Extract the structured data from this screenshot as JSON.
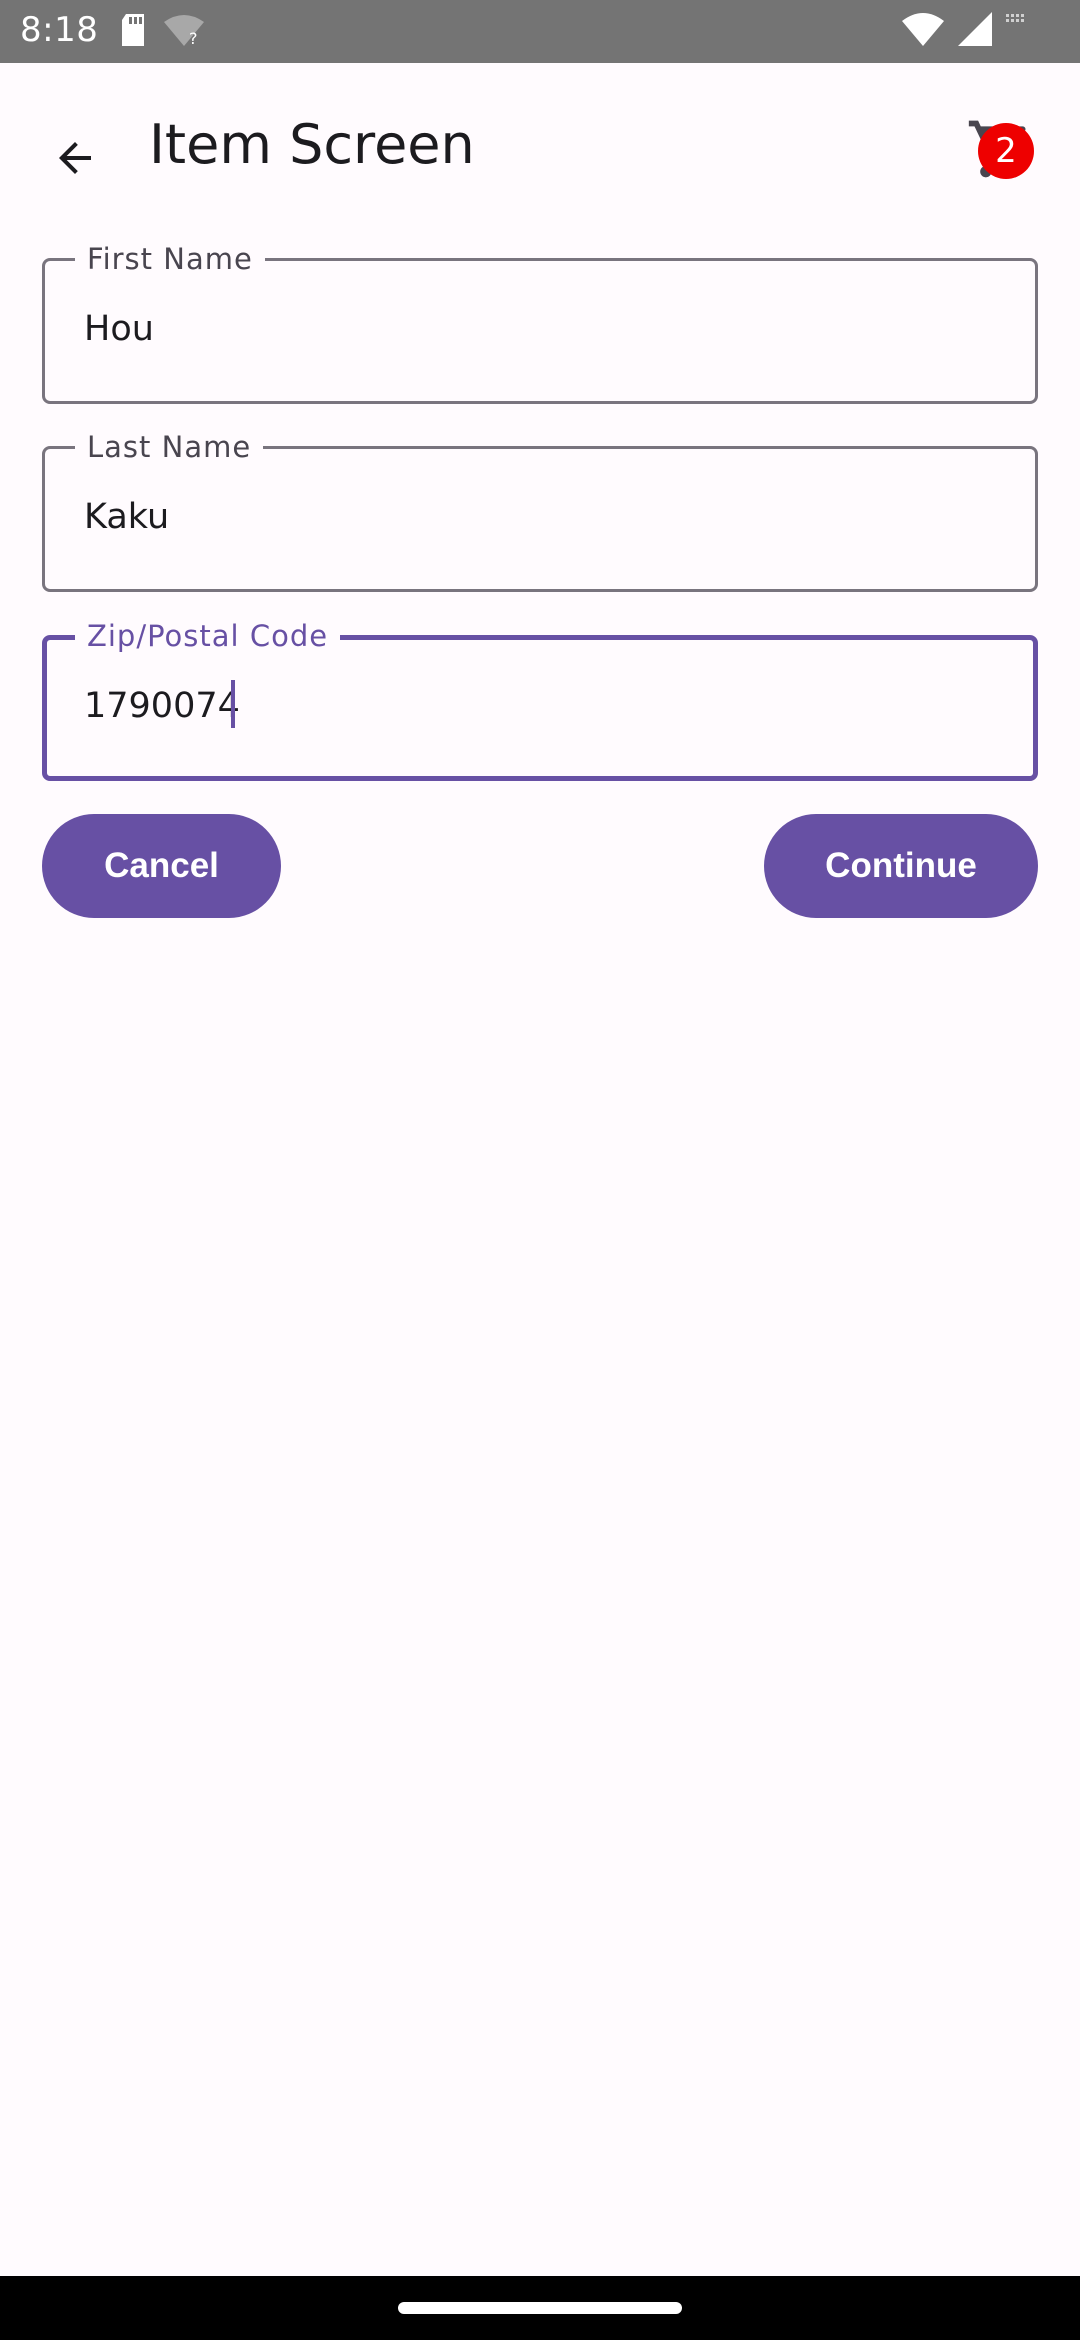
{
  "status_bar": {
    "time": "8:18",
    "icons": [
      "sd-card-icon",
      "wifi-question-icon",
      "wifi-icon",
      "signal-icon"
    ],
    "background": "#747474"
  },
  "app_bar": {
    "title": "Item Screen",
    "back_icon": "arrow-back-icon",
    "cart_icon": "shopping-cart-icon",
    "cart_badge_count": "2",
    "badge_color": "#ee0000"
  },
  "form": {
    "first_name": {
      "label": "First Name",
      "value": "Hou"
    },
    "last_name": {
      "label": "Last Name",
      "value": "Kaku"
    },
    "zip_code": {
      "label": "Zip/Postal Code",
      "value": "1790074"
    }
  },
  "actions": {
    "cancel_label": "Cancel",
    "continue_label": "Continue"
  },
  "colors": {
    "accent": "#6750a4",
    "background": "#fffbfe",
    "outline": "#79747e"
  }
}
